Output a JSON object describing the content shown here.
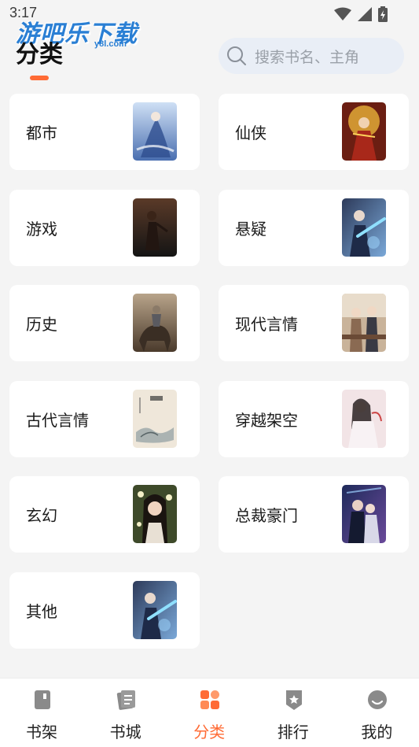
{
  "status_bar": {
    "time": "3:17"
  },
  "watermark": {
    "text": "游吧乐下载",
    "sub": "y8l.com"
  },
  "page": {
    "title": "分类"
  },
  "search": {
    "placeholder": "搜索书名、主角"
  },
  "categories": [
    {
      "label": "都市",
      "cover": "cover-blue-warrior"
    },
    {
      "label": "仙侠",
      "cover": "cover-golden-warrior"
    },
    {
      "label": "游戏",
      "cover": "cover-dark-figure"
    },
    {
      "label": "悬疑",
      "cover": "cover-blue-sword"
    },
    {
      "label": "历史",
      "cover": "cover-horse-rider"
    },
    {
      "label": "现代言情",
      "cover": "cover-couple-cafe"
    },
    {
      "label": "古代言情",
      "cover": "cover-ink-book"
    },
    {
      "label": "穿越架空",
      "cover": "cover-couple-pink"
    },
    {
      "label": "玄幻",
      "cover": "cover-girl-flowers"
    },
    {
      "label": "总裁豪门",
      "cover": "cover-night-couple"
    },
    {
      "label": "其他",
      "cover": "cover-blue-sword"
    }
  ],
  "bottom_nav": {
    "active": "分类",
    "items": [
      {
        "label": "书架",
        "icon": "bookshelf-icon"
      },
      {
        "label": "书城",
        "icon": "bookstore-icon"
      },
      {
        "label": "分类",
        "icon": "category-grid-icon"
      },
      {
        "label": "排行",
        "icon": "ranking-badge-icon"
      },
      {
        "label": "我的",
        "icon": "profile-icon"
      }
    ]
  },
  "colors": {
    "accent": "#ff6b35",
    "search_bg": "#e9eef6",
    "page_bg": "#f4f4f4"
  }
}
